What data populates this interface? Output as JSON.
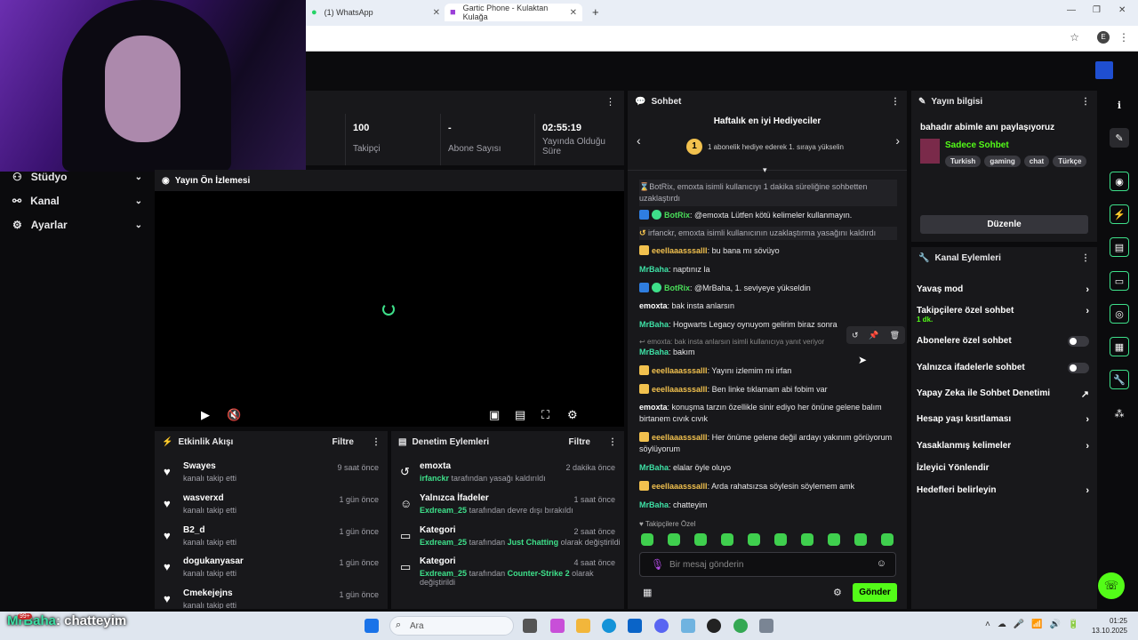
{
  "browser": {
    "tabs": [
      {
        "label": "(1) WhatsApp",
        "close": "✕"
      },
      {
        "label": "Gartic Phone - Kulaktan Kulağa",
        "close": "✕"
      }
    ],
    "new_tab": "+",
    "profile": "E"
  },
  "sidebar": {
    "items": [
      {
        "label": "Stüdyo",
        "icon": "studio-icon"
      },
      {
        "label": "Kanal",
        "icon": "channel-icon"
      },
      {
        "label": "Ayarlar",
        "icon": "gear-icon"
      }
    ]
  },
  "stats": [
    {
      "value": "100",
      "label": "Takipçi"
    },
    {
      "value": "-",
      "label": "Abone Sayısı"
    },
    {
      "value": "02:55:19",
      "label": "Yayında Olduğu Süre"
    }
  ],
  "preview": {
    "title": "Yayın Ön İzlemesi"
  },
  "activity": {
    "title": "Etkinlik Akışı",
    "filter": "Filtre",
    "items": [
      {
        "name": "Swayes",
        "desc": "kanalı takip etti",
        "time": "9 saat önce"
      },
      {
        "name": "wasverxd",
        "desc": "kanalı takip etti",
        "time": "1 gün önce"
      },
      {
        "name": "B2_d",
        "desc": "kanalı takip etti",
        "time": "1 gün önce"
      },
      {
        "name": "dogukanyasar",
        "desc": "kanalı takip etti",
        "time": "1 gün önce"
      },
      {
        "name": "Cmekejejns",
        "desc": "kanalı takip etti",
        "time": "1 gün önce"
      }
    ]
  },
  "moderation": {
    "title": "Denetim Eylemleri",
    "filter": "Filtre",
    "items": [
      {
        "name": "emoxta",
        "who": "irfanckr",
        "rest": "tarafından yasağı kaldırıldı",
        "time": "2 dakika önce"
      },
      {
        "name": "Yalnızca İfadeler",
        "who": "Exdream_25",
        "rest": "tarafından devre dışı bırakıldı",
        "time": "1 saat önce"
      },
      {
        "name": "Kategori",
        "who": "Exdream_25",
        "rest": "tarafından",
        "cat": "Just Chatting",
        "rest2": "olarak değiştirildi",
        "time": "2 saat önce"
      },
      {
        "name": "Kategori",
        "who": "Exdream_25",
        "rest": "tarafından",
        "cat": "Counter-Strike 2",
        "rest2": "olarak değiştirildi",
        "time": "4 saat önce"
      }
    ]
  },
  "chat": {
    "title": "Sohbet",
    "gifter_title": "Haftalık en iyi Hediyeciler",
    "gifter_rank": "1",
    "gifter_text": "1 abonelik hediye ederek 1. sıraya yükselin",
    "messages": [
      {
        "user": "",
        "text": "BotRix, emoxta isimli kullanıcıyı 1 dakika süreliğine sohbetten uzaklaştırdı"
      },
      {
        "user": "BotRix",
        "text": ": @emoxta Lütfen kötü kelimeler kullanmayın."
      },
      {
        "user": "",
        "text": "irfanckr, emoxta isimli kullanıcının uzaklaştırma yasağını kaldırdı"
      },
      {
        "user": "eeellaaasssalll",
        "text": ": bu bana mı sövüyo"
      },
      {
        "user": "MrBaha",
        "text": ": naptınız la"
      },
      {
        "user": "BotRix",
        "text": ": @MrBaha, 1. seviyeye yükseldin"
      },
      {
        "user": "emoxta",
        "text": ": bak insta anlarsın"
      },
      {
        "user": "MrBaha",
        "text": ": Hogwarts Legacy oynuyom gelirim biraz sonra"
      },
      {
        "user": "",
        "text": "emoxta: bak insta anlarsın isimli kullanıcıya yanıt veriyor"
      },
      {
        "user": "MrBaha",
        "text": ": bakım"
      },
      {
        "user": "eeellaaasssalll",
        "text": ": Yayını izlemim mi irfan"
      },
      {
        "user": "eeellaaasssalll",
        "text": ": Ben linke tıklamam abi fobim var"
      },
      {
        "user": "emoxta",
        "text": ": konuşma tarzın özellikle sinir ediyo her önüne gelene balım birtanem cıvık cıvık"
      },
      {
        "user": "eeellaaasssalll",
        "text": ": Her önüme gelene değil ardayı yakınım görüyorum söylüyorum"
      },
      {
        "user": "MrBaha",
        "text": ": elalar öyle oluyo"
      },
      {
        "user": "eeellaaasssalll",
        "text": ": Arda rahatsızsa söylesin söylemem amk"
      },
      {
        "user": "MrBaha",
        "text": ": chatteyim"
      }
    ],
    "followers_only": "Takipçilere Özel",
    "placeholder": "Bir mesaj gönderin",
    "send": "Gönder"
  },
  "info": {
    "title": "Yayın bilgisi",
    "stream_title": "bahadır abimle anı paylaşıyoruz",
    "category": "Sadece Sohbet",
    "tags": [
      "Turkish",
      "gaming",
      "chat",
      "Türkçe"
    ],
    "edit": "Düzenle"
  },
  "actions": {
    "title": "Kanal Eylemleri",
    "items": [
      {
        "label": "Yavaş mod"
      },
      {
        "label": "Takipçilere özel sohbet",
        "sub": "1 dk."
      },
      {
        "label": "Abonelere özel sohbet"
      },
      {
        "label": "Yalnızca ifadelerle sohbet"
      },
      {
        "label": "Yapay Zeka ile Sohbet Denetimi"
      },
      {
        "label": "Hesap yaşı kısıtlaması"
      },
      {
        "label": "Yasaklanmış kelimeler"
      },
      {
        "label": "İzleyici Yönlendir"
      },
      {
        "label": "Hedefleri belirleyin"
      }
    ]
  },
  "overlay": {
    "name": "MrBaha",
    "text": ": chatteyim",
    "notify": "99+"
  },
  "taskbar": {
    "search": "Ara",
    "time": "01:25",
    "date": "13.10.2025"
  },
  "colors": {
    "accent": "#53fc18",
    "bg": "#0b0b0d",
    "panel": "#18181b"
  }
}
